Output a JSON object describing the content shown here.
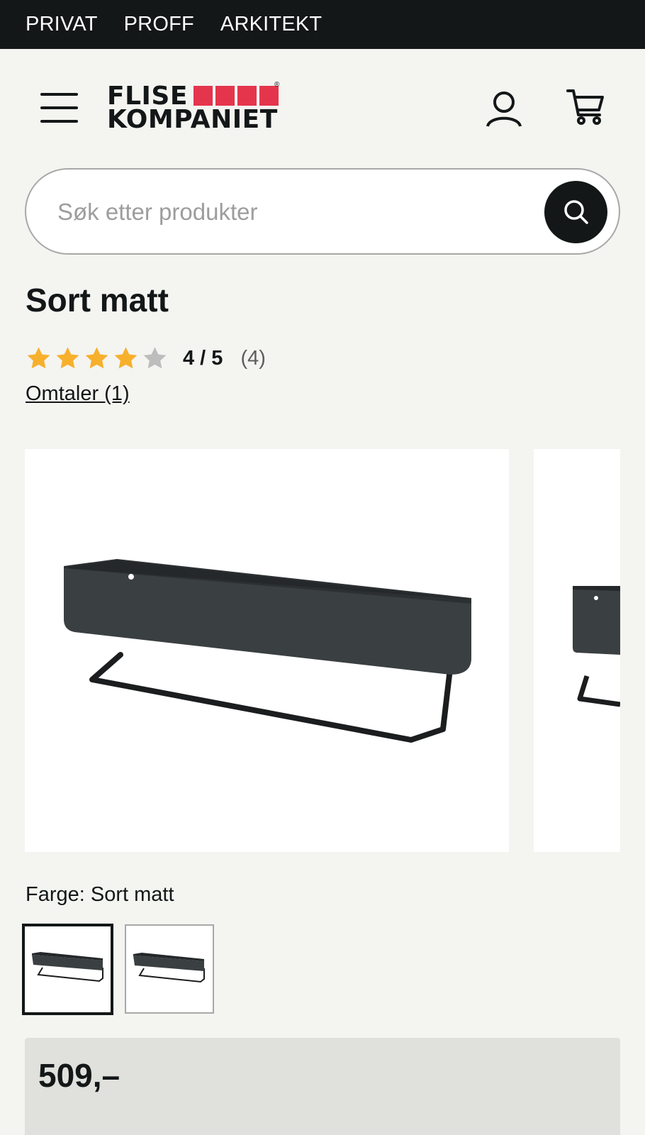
{
  "topbar": {
    "links": [
      "PRIVAT",
      "PROFF",
      "ARKITEKT"
    ]
  },
  "logo": {
    "line1": "FLISE",
    "line2": "KOMPANIET",
    "registered": "®",
    "brand_color": "#e4354d"
  },
  "header": {
    "icons": [
      "menu-icon",
      "user-icon",
      "cart-icon"
    ]
  },
  "search": {
    "placeholder": "Søk etter produkter",
    "value": ""
  },
  "product": {
    "title": "Sort matt",
    "rating": {
      "value": 4,
      "max": 5,
      "display": "4 / 5",
      "count": "(4)"
    },
    "reviews_link": "Omtaler (1)",
    "color_label": "Farge: Sort matt",
    "price": "509,–"
  },
  "colors": {
    "dark": "#131718",
    "background": "#f4f4f1",
    "star_filled": "#f7b02c",
    "star_empty": "#bdbdbd",
    "price_bg": "#e0e0dc"
  }
}
